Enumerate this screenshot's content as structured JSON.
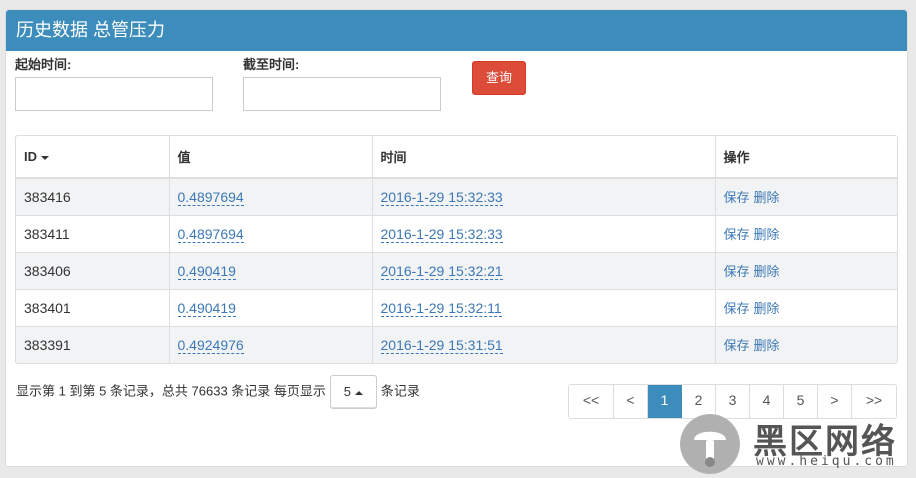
{
  "header": {
    "title": "历史数据 总管压力"
  },
  "filters": {
    "start_label": "起始时间:",
    "start_value": "",
    "end_label": "截至时间:",
    "end_value": "",
    "search_label": "查询"
  },
  "table": {
    "columns": [
      "ID",
      "值",
      "时间",
      "操作"
    ],
    "rows": [
      {
        "id": "383416",
        "value": "0.4897694",
        "time": "2016-1-29 15:32:33"
      },
      {
        "id": "383411",
        "value": "0.4897694",
        "time": "2016-1-29 15:32:33"
      },
      {
        "id": "383406",
        "value": "0.490419",
        "time": "2016-1-29 15:32:21"
      },
      {
        "id": "383401",
        "value": "0.490419",
        "time": "2016-1-29 15:32:11"
      },
      {
        "id": "383391",
        "value": "0.4924976",
        "time": "2016-1-29 15:31:51"
      }
    ],
    "actions": {
      "save": "保存",
      "delete": "删除"
    }
  },
  "footer": {
    "info_prefix": "显示第 1 到第 5 条记录，总共 76633 条记录 每页显示",
    "page_size": "5",
    "info_suffix": "条记录"
  },
  "pagination": [
    "<<",
    "<",
    "1",
    "2",
    "3",
    "4",
    "5",
    ">",
    ">>"
  ],
  "watermark": {
    "name": "黑区网络",
    "url": "www.heiqu.com"
  },
  "colors": {
    "header": "#3c8dbc",
    "danger": "#dd4b39",
    "link": "#3c78b5"
  }
}
